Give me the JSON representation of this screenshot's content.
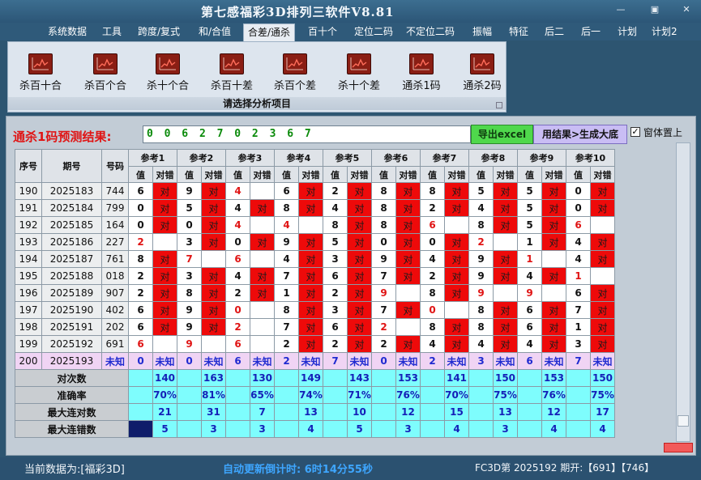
{
  "window": {
    "title": "第七感福彩3D排列三软件V8.81",
    "minimize": "—",
    "restore": "▣",
    "close": "✕"
  },
  "menu": [
    "系统数据",
    "工具",
    "跨度/复式",
    "和/合值",
    "合差/通杀",
    "百十个",
    "定位二码",
    "不定位二码",
    "振幅",
    "特征",
    "后二",
    "后一",
    "计划",
    "计划2"
  ],
  "menu_active_index": 4,
  "ribbon": {
    "buttons": [
      {
        "label": "杀百十合",
        "icon": "chart-icon"
      },
      {
        "label": "杀百个合",
        "icon": "chart-icon"
      },
      {
        "label": "杀十个合",
        "icon": "chart-icon"
      },
      {
        "label": "杀百十差",
        "icon": "chart-icon"
      },
      {
        "label": "杀百个差",
        "icon": "chart-icon"
      },
      {
        "label": "杀十个差",
        "icon": "chart-icon"
      },
      {
        "label": "通杀1码",
        "icon": "chart-icon"
      },
      {
        "label": "通杀2码",
        "icon": "chart-icon"
      }
    ],
    "caption": "请选择分析项目"
  },
  "prediction": {
    "label": "通杀1码预测结果:",
    "value": "0 0 6 2 7 0 2 3 6 7",
    "export": "导出excel",
    "generate": "用结果>生成大底",
    "ontop_label": "窗体置上",
    "ontop_checked": "✓"
  },
  "colors": {
    "hit": "#ee0a0a",
    "pending": "#f0d4f4",
    "stats": "#7efdfd",
    "red_value": "#e01414"
  },
  "table": {
    "head": {
      "no": "序号",
      "issue": "期号",
      "draw": "号码",
      "value": "值",
      "result": "对错",
      "refs": [
        "参考1",
        "参考2",
        "参考3",
        "参考4",
        "参考5",
        "参考6",
        "参考7",
        "参考8",
        "参考9",
        "参考10"
      ]
    },
    "rows": [
      {
        "no": "190",
        "issue": "2025183",
        "draw": "744",
        "cells": [
          [
            "6",
            "对",
            0
          ],
          [
            "9",
            "对",
            0
          ],
          [
            "4",
            "",
            1
          ],
          [
            "6",
            "对",
            0
          ],
          [
            "2",
            "对",
            0
          ],
          [
            "8",
            "对",
            0
          ],
          [
            "8",
            "对",
            0
          ],
          [
            "5",
            "对",
            0
          ],
          [
            "5",
            "对",
            0
          ],
          [
            "0",
            "对",
            0
          ]
        ]
      },
      {
        "no": "191",
        "issue": "2025184",
        "draw": "799",
        "cells": [
          [
            "0",
            "对",
            0
          ],
          [
            "5",
            "对",
            0
          ],
          [
            "4",
            "对",
            0
          ],
          [
            "8",
            "对",
            0
          ],
          [
            "4",
            "对",
            0
          ],
          [
            "8",
            "对",
            0
          ],
          [
            "2",
            "对",
            0
          ],
          [
            "4",
            "对",
            0
          ],
          [
            "5",
            "对",
            0
          ],
          [
            "0",
            "对",
            0
          ]
        ]
      },
      {
        "no": "192",
        "issue": "2025185",
        "draw": "164",
        "cells": [
          [
            "0",
            "对",
            0
          ],
          [
            "0",
            "对",
            0
          ],
          [
            "4",
            "",
            1
          ],
          [
            "4",
            "",
            1
          ],
          [
            "8",
            "对",
            0
          ],
          [
            "8",
            "对",
            0
          ],
          [
            "6",
            "",
            1
          ],
          [
            "8",
            "对",
            0
          ],
          [
            "5",
            "对",
            0
          ],
          [
            "6",
            "",
            1
          ]
        ]
      },
      {
        "no": "193",
        "issue": "2025186",
        "draw": "227",
        "cells": [
          [
            "2",
            "",
            1
          ],
          [
            "3",
            "对",
            0
          ],
          [
            "0",
            "对",
            0
          ],
          [
            "9",
            "对",
            0
          ],
          [
            "5",
            "对",
            0
          ],
          [
            "0",
            "对",
            0
          ],
          [
            "0",
            "对",
            0
          ],
          [
            "2",
            "",
            1
          ],
          [
            "1",
            "对",
            0
          ],
          [
            "4",
            "对",
            0
          ]
        ]
      },
      {
        "no": "194",
        "issue": "2025187",
        "draw": "761",
        "cells": [
          [
            "8",
            "对",
            0
          ],
          [
            "7",
            "",
            1
          ],
          [
            "6",
            "",
            1
          ],
          [
            "4",
            "对",
            0
          ],
          [
            "3",
            "对",
            0
          ],
          [
            "9",
            "对",
            0
          ],
          [
            "4",
            "对",
            0
          ],
          [
            "9",
            "对",
            0
          ],
          [
            "1",
            "",
            1
          ],
          [
            "4",
            "对",
            0
          ]
        ]
      },
      {
        "no": "195",
        "issue": "2025188",
        "draw": "018",
        "cells": [
          [
            "2",
            "对",
            0
          ],
          [
            "3",
            "对",
            0
          ],
          [
            "4",
            "对",
            0
          ],
          [
            "7",
            "对",
            0
          ],
          [
            "6",
            "对",
            0
          ],
          [
            "7",
            "对",
            0
          ],
          [
            "2",
            "对",
            0
          ],
          [
            "9",
            "对",
            0
          ],
          [
            "4",
            "对",
            0
          ],
          [
            "1",
            "",
            1
          ]
        ]
      },
      {
        "no": "196",
        "issue": "2025189",
        "draw": "907",
        "cells": [
          [
            "2",
            "对",
            0
          ],
          [
            "8",
            "对",
            0
          ],
          [
            "2",
            "对",
            0
          ],
          [
            "1",
            "对",
            0
          ],
          [
            "2",
            "对",
            0
          ],
          [
            "9",
            "",
            1
          ],
          [
            "8",
            "对",
            0
          ],
          [
            "9",
            "",
            1
          ],
          [
            "9",
            "",
            1
          ],
          [
            "6",
            "对",
            0
          ]
        ]
      },
      {
        "no": "197",
        "issue": "2025190",
        "draw": "402",
        "cells": [
          [
            "6",
            "对",
            0
          ],
          [
            "9",
            "对",
            0
          ],
          [
            "0",
            "",
            1
          ],
          [
            "8",
            "对",
            0
          ],
          [
            "3",
            "对",
            0
          ],
          [
            "7",
            "对",
            0
          ],
          [
            "0",
            "",
            1
          ],
          [
            "8",
            "对",
            0
          ],
          [
            "6",
            "对",
            0
          ],
          [
            "7",
            "对",
            0
          ]
        ]
      },
      {
        "no": "198",
        "issue": "2025191",
        "draw": "202",
        "cells": [
          [
            "6",
            "对",
            0
          ],
          [
            "9",
            "对",
            0
          ],
          [
            "2",
            "",
            1
          ],
          [
            "7",
            "对",
            0
          ],
          [
            "6",
            "对",
            0
          ],
          [
            "2",
            "",
            1
          ],
          [
            "8",
            "对",
            0
          ],
          [
            "8",
            "对",
            0
          ],
          [
            "6",
            "对",
            0
          ],
          [
            "1",
            "对",
            0
          ]
        ]
      },
      {
        "no": "199",
        "issue": "2025192",
        "draw": "691",
        "cells": [
          [
            "6",
            "",
            1
          ],
          [
            "9",
            "",
            1
          ],
          [
            "6",
            "",
            1
          ],
          [
            "2",
            "对",
            0
          ],
          [
            "2",
            "对",
            0
          ],
          [
            "2",
            "对",
            0
          ],
          [
            "4",
            "对",
            0
          ],
          [
            "4",
            "对",
            0
          ],
          [
            "4",
            "对",
            0
          ],
          [
            "3",
            "对",
            0
          ]
        ]
      }
    ],
    "pending": {
      "no": "200",
      "issue": "2025193",
      "draw": "未知",
      "values": [
        "0",
        "0",
        "6",
        "2",
        "7",
        "0",
        "2",
        "3",
        "6",
        "7"
      ],
      "result": "未知"
    },
    "stats": [
      {
        "label": "对次数",
        "values": [
          "140",
          "163",
          "130",
          "149",
          "143",
          "153",
          "141",
          "150",
          "153",
          "150"
        ]
      },
      {
        "label": "准确率",
        "values": [
          "70%",
          "81%",
          "65%",
          "74%",
          "71%",
          "76%",
          "70%",
          "75%",
          "76%",
          "75%"
        ]
      },
      {
        "label": "最大连对数",
        "values": [
          "21",
          "31",
          "7",
          "13",
          "10",
          "12",
          "15",
          "13",
          "12",
          "17"
        ]
      },
      {
        "label": "最大连错数",
        "values": [
          "5",
          "3",
          "3",
          "4",
          "5",
          "3",
          "4",
          "3",
          "4",
          "4"
        ]
      }
    ]
  },
  "status": {
    "current": "当前数据为:[福彩3D]",
    "countdown": "自动更新倒计时: 6时14分55秒",
    "draw_info": "FC3D第 2025192 期开:【691】【746】"
  }
}
